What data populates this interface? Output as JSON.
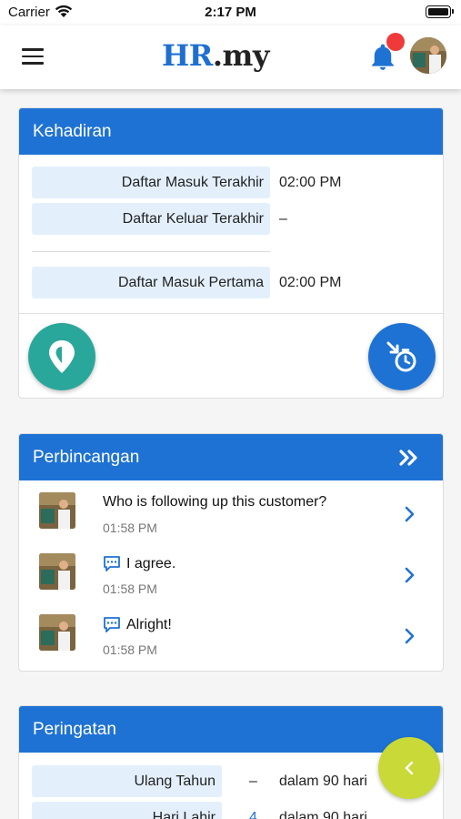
{
  "status_bar": {
    "carrier": "Carrier",
    "time": "2:17 PM"
  },
  "app": {
    "logo_hr": "HR",
    "logo_my": ".my"
  },
  "attendance": {
    "title": "Kehadiran",
    "rows": [
      {
        "label": "Daftar Masuk Terakhir",
        "value": "02:00 PM"
      },
      {
        "label": "Daftar Keluar Terakhir",
        "value": "–"
      },
      {
        "label": "Daftar Masuk Pertama",
        "value": "02:00 PM"
      }
    ]
  },
  "discussion": {
    "title": "Perbincangan",
    "messages": [
      {
        "text": "Who is following up this customer?",
        "time": "01:58 PM",
        "is_reply": false
      },
      {
        "text": "I agree.",
        "time": "01:58 PM",
        "is_reply": true
      },
      {
        "text": "Alright!",
        "time": "01:58 PM",
        "is_reply": true
      }
    ]
  },
  "reminders": {
    "title": "Peringatan",
    "rows": [
      {
        "label": "Ulang Tahun",
        "count": "–",
        "value": "dalam 90 hari"
      },
      {
        "label": "Hari Lahir",
        "count": "4",
        "value": "dalam 90 hari"
      }
    ]
  },
  "colors": {
    "primary": "#1e72d4",
    "accent_green": "#2aa79b",
    "accent_lime": "#c8d938",
    "notification": "#f03a3a",
    "label_bg": "#e3f0fc"
  },
  "icons": {
    "menu": "menu-icon",
    "bell": "bell-icon",
    "location": "location-pin-icon",
    "clock_in": "clock-in-icon",
    "more": "double-chevron-right-icon",
    "chat": "chat-bubble-icon",
    "row_arrow": "chevron-right-icon",
    "back": "chevron-left-icon"
  }
}
